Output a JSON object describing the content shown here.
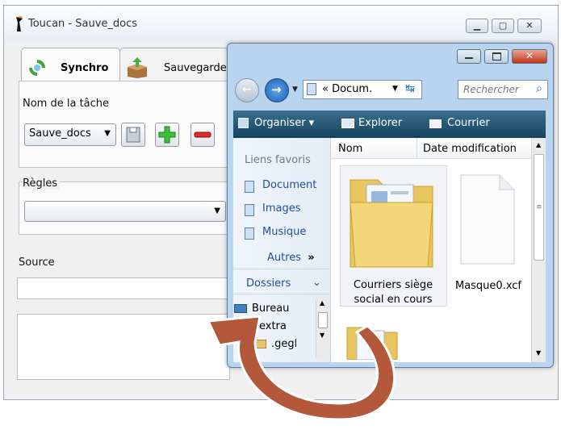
{
  "toucan": {
    "title": "Toucan - Sauve_docs",
    "tabs": [
      {
        "label": "Synchro",
        "icon": "sync-icon"
      },
      {
        "label": "Sauvegarde",
        "icon": "backup-box-icon"
      }
    ],
    "task_name_label": "Nom de la tâche",
    "task_selected": "Sauve_docs",
    "rules_label": "Règles",
    "rules_selected": "",
    "source_label": "Source"
  },
  "explorer": {
    "address_text": "« Docum.",
    "search_placeholder": "Rechercher",
    "toolbar": {
      "organize": "Organiser",
      "explore": "Explorer",
      "mail": "Courrier"
    },
    "favorites_header": "Liens favoris",
    "favorites": [
      "Document",
      "Images",
      "Musique"
    ],
    "more_label": "Autres",
    "more_arrows": "»",
    "folders_label": "Dossiers",
    "tree_items": [
      "Bureau",
      "extra",
      ".gegl"
    ],
    "columns": [
      "Nom",
      "Date modification"
    ],
    "files": [
      {
        "name": "Courriers siège social en cours",
        "type": "folder"
      },
      {
        "name": "Masque0.xcf",
        "type": "file"
      }
    ]
  },
  "colors": {
    "arrow": "#b3583a",
    "toolbar": "#1f4f6e",
    "link": "#1d4f9e"
  }
}
